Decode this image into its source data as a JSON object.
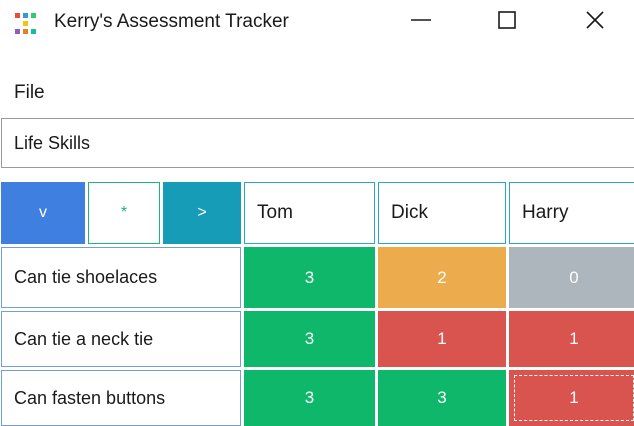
{
  "window": {
    "title": "Kerry's Assessment Tracker",
    "minimize_glyph": "—",
    "close_glyph": "✕"
  },
  "menu": {
    "file": "File"
  },
  "subject": {
    "value": "Life Skills"
  },
  "controls": {
    "collapse": "v",
    "add": "*",
    "next": ">"
  },
  "students": [
    "Tom",
    "Dick",
    "Harry"
  ],
  "skills": [
    {
      "label": "Can tie shoelaces",
      "scores": [
        "3",
        "2",
        "0"
      ]
    },
    {
      "label": "Can tie a neck tie",
      "scores": [
        "3",
        "1",
        "1"
      ]
    },
    {
      "label": "Can fasten buttons",
      "scores": [
        "3",
        "3",
        "1"
      ]
    }
  ],
  "colors": {
    "score_3": "#0fb76a",
    "score_2": "#ecab4c",
    "score_1": "#d9534f",
    "score_0": "#adb5bd",
    "collapse_button": "#3f7fe0",
    "next_button": "#179cb8",
    "add_button_border": "#20b27a"
  }
}
